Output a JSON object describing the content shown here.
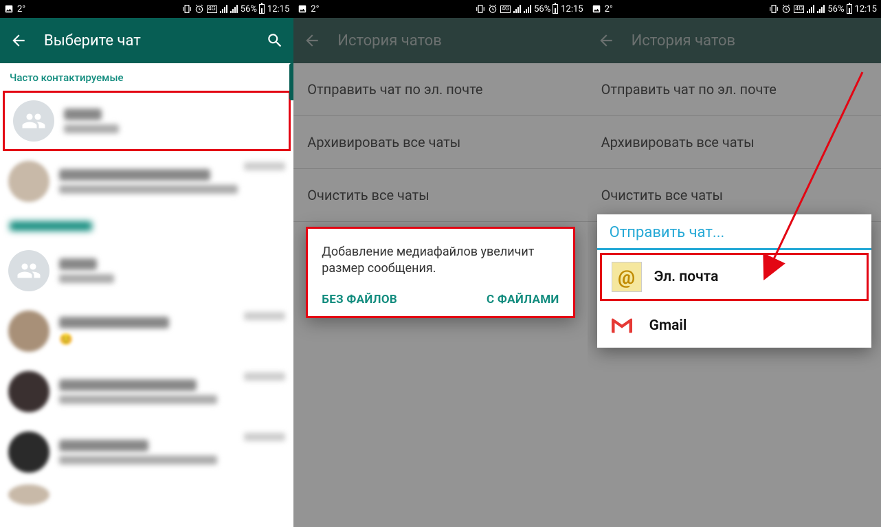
{
  "statusbar": {
    "temperature": "2°",
    "battery_pct": "56%",
    "time": "12:15",
    "network_badge": "4G"
  },
  "screen1": {
    "title": "Выберите чат",
    "section_header": "Часто контактируемые"
  },
  "screen2": {
    "title": "История чатов",
    "items": {
      "email_chat": "Отправить чат по эл. почте",
      "archive_all": "Архивировать все чаты",
      "clear_all": "Очистить все чаты"
    },
    "dialog": {
      "message": "Добавление медиафайлов увеличит размер сообщения.",
      "btn_no_files": "БЕЗ ФАЙЛОВ",
      "btn_with_files": "С ФАЙЛАМИ"
    }
  },
  "screen3": {
    "title": "История чатов",
    "items": {
      "email_chat": "Отправить чат по эл. почте",
      "archive_all": "Архивировать все чаты",
      "clear_all": "Очистить все чаты"
    },
    "share": {
      "title": "Отправить чат...",
      "email_label": "Эл. почта",
      "gmail_label": "Gmail"
    }
  }
}
